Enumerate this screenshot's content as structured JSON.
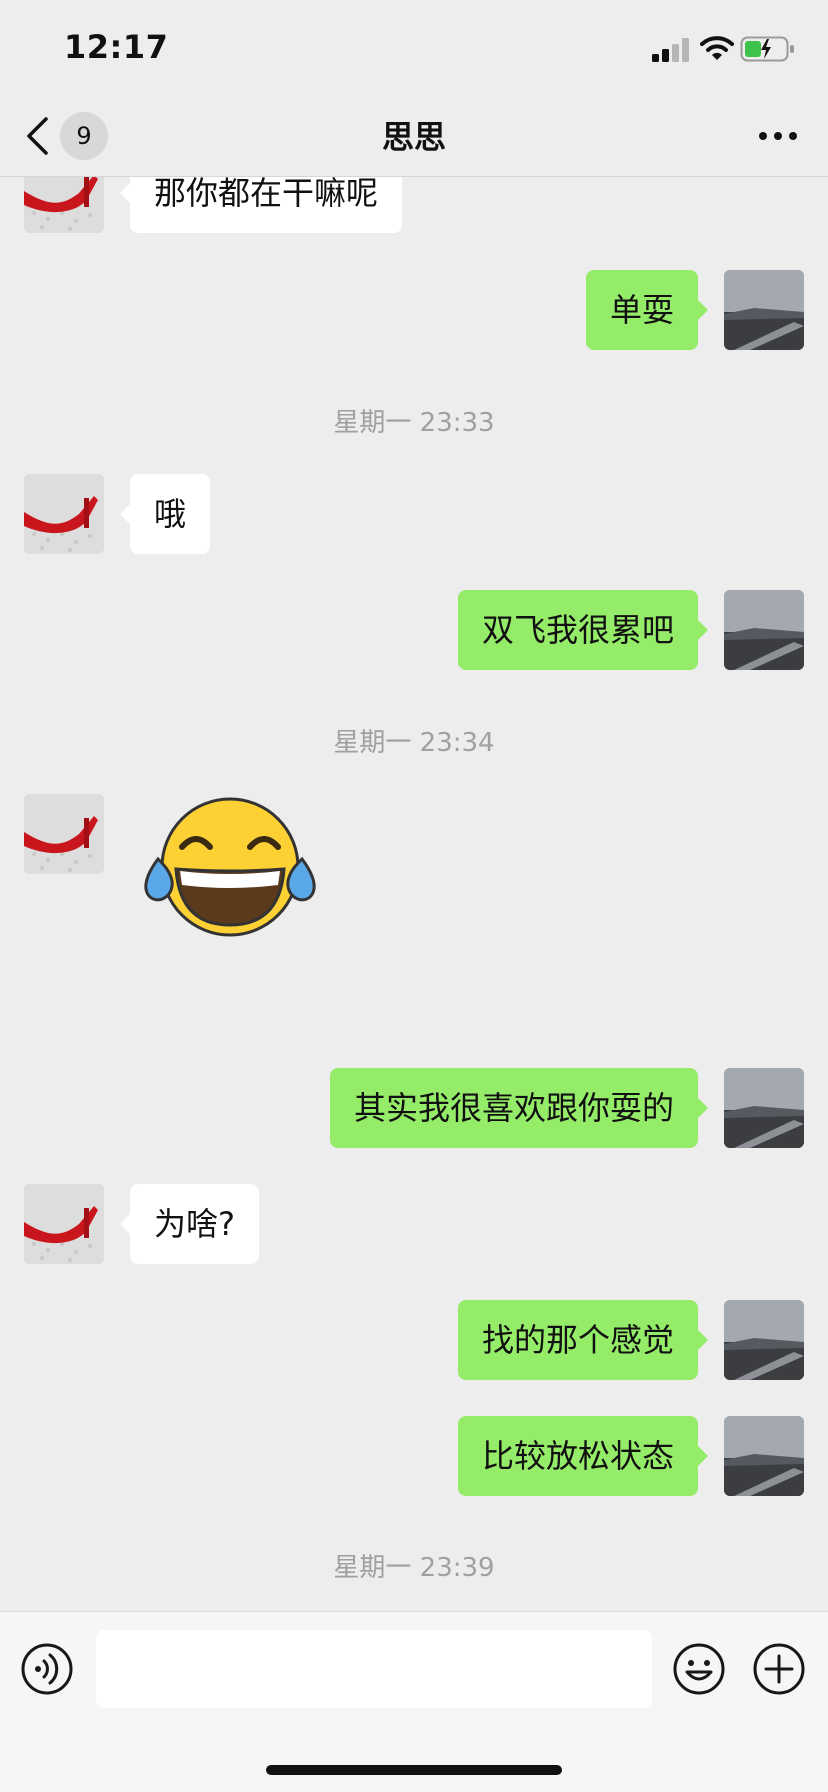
{
  "status_bar": {
    "time": "12:17"
  },
  "header": {
    "unread_count": "9",
    "title": "思思",
    "more_icon": "more-dots-icon"
  },
  "messages": [
    {
      "from": "contact",
      "text": "那你都在干嘛呢"
    },
    {
      "from": "me",
      "text": "单耍"
    },
    {
      "type": "time",
      "text": "星期一 23:33"
    },
    {
      "from": "contact",
      "text": "哦"
    },
    {
      "from": "me",
      "text": "双飞我很累吧"
    },
    {
      "type": "time",
      "text": "星期一 23:34"
    },
    {
      "from": "contact",
      "sticker": "tears-of-joy-emoji"
    },
    {
      "from": "me",
      "text": "其实我很喜欢跟你耍的"
    },
    {
      "from": "contact",
      "text": "为啥?"
    },
    {
      "from": "me",
      "text": "找的那个感觉"
    },
    {
      "from": "me",
      "text": "比较放松状态"
    },
    {
      "type": "time",
      "text": "星期一 23:39"
    }
  ],
  "input_bar": {
    "value": "",
    "voice_icon": "voice-icon",
    "emoji_icon": "emoji-icon",
    "plus_icon": "plus-icon"
  },
  "colors": {
    "background": "#ededed",
    "outgoing_bubble": "#95ec69",
    "incoming_bubble": "#ffffff",
    "time_text": "#a0a0a0"
  }
}
